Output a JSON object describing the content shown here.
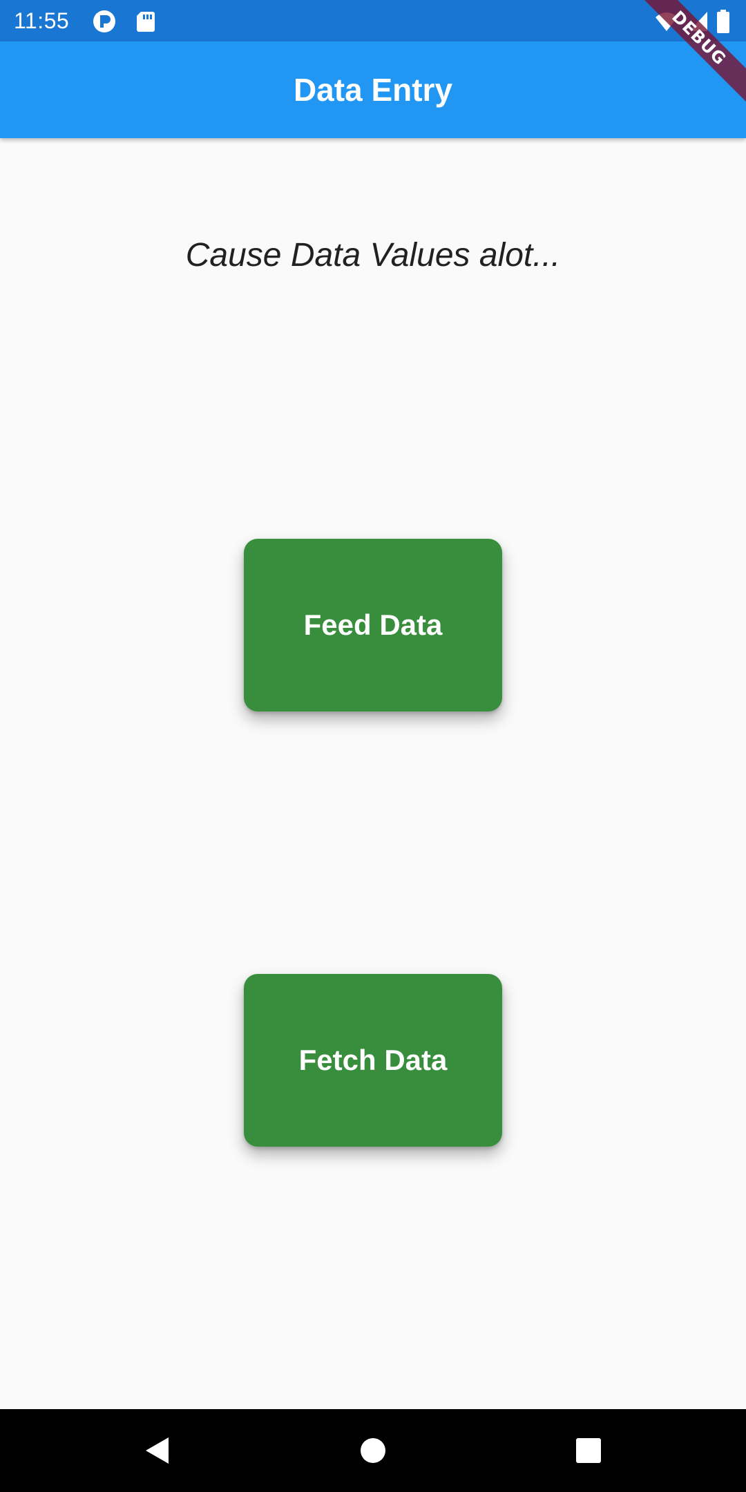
{
  "status_bar": {
    "time": "11:55",
    "left_icons": [
      "notification-p-icon",
      "sd-card-icon"
    ],
    "right_icons": [
      "wifi-icon",
      "signal-icon",
      "battery-icon"
    ],
    "background": "#1976D2"
  },
  "debug_banner": {
    "label": "DEBUG"
  },
  "app_bar": {
    "title": "Data Entry",
    "background": "#2196F3"
  },
  "main": {
    "subtitle": "Cause Data Values alot...",
    "buttons": [
      {
        "label": "Feed Data",
        "color": "#388E3C"
      },
      {
        "label": "Fetch Data",
        "color": "#388E3C"
      }
    ]
  },
  "nav_bar": {
    "buttons": [
      "back-icon",
      "home-icon",
      "recents-icon"
    ]
  }
}
